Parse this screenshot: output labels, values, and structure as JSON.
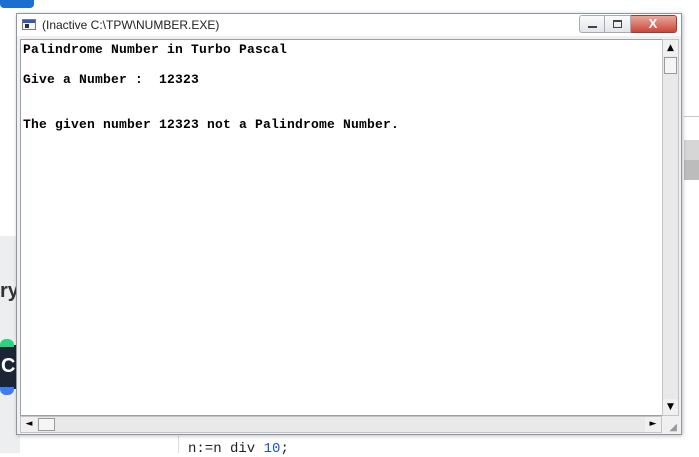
{
  "window": {
    "title": "(Inactive C:\\TPW\\NUMBER.EXE)",
    "icon": "app-window-icon"
  },
  "caption_buttons": {
    "minimize_icon": "minimize-icon",
    "maximize_icon": "maximize-icon",
    "close_glyph": "X"
  },
  "console": {
    "lines": [
      "Palindrome Number in Turbo Pascal",
      "Give a Number :  12323",
      "The given number 12323 not a Palindrome Number."
    ]
  },
  "scrollbars": {
    "up_arrow": "▲",
    "down_arrow": "▼",
    "left_arrow": "◄",
    "right_arrow": "►",
    "grip": "◢"
  },
  "background": {
    "partial_text": "ry",
    "c_icon_letter": "C",
    "code_prefix": "n:=n div ",
    "code_number": "10",
    "code_suffix": ";"
  }
}
